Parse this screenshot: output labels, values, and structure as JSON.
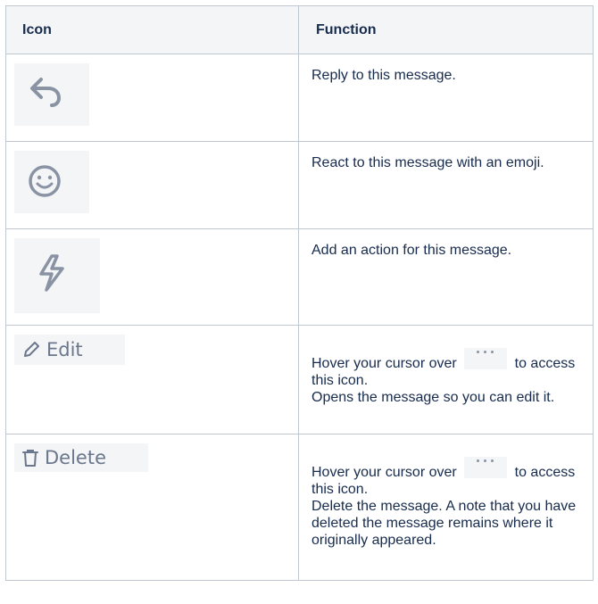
{
  "table": {
    "headers": [
      "Icon",
      "Function"
    ],
    "rows": [
      {
        "icon": "reply-icon",
        "function": "Reply to this message."
      },
      {
        "icon": "smile-icon",
        "function": "React to this message with an emoji."
      },
      {
        "icon": "lightning-icon",
        "function": "Add an action for this message."
      },
      {
        "icon": "pencil-icon",
        "icon_label": "Edit",
        "function_prefix": "Hover your cursor over",
        "function_suffix": "to access this icon.",
        "function_detail": "Opens the message so you can edit it."
      },
      {
        "icon": "trash-icon",
        "icon_label": "Delete",
        "function_prefix": "Hover your cursor over",
        "function_suffix": "to access this icon.",
        "function_detail": "Delete the message. A note that you have deleted the message remains where it originally appeared."
      }
    ]
  },
  "colors": {
    "border": "#c1c7d0",
    "header_bg": "#f4f5f7",
    "text": "#172b4d",
    "icon": "#8993a4"
  }
}
